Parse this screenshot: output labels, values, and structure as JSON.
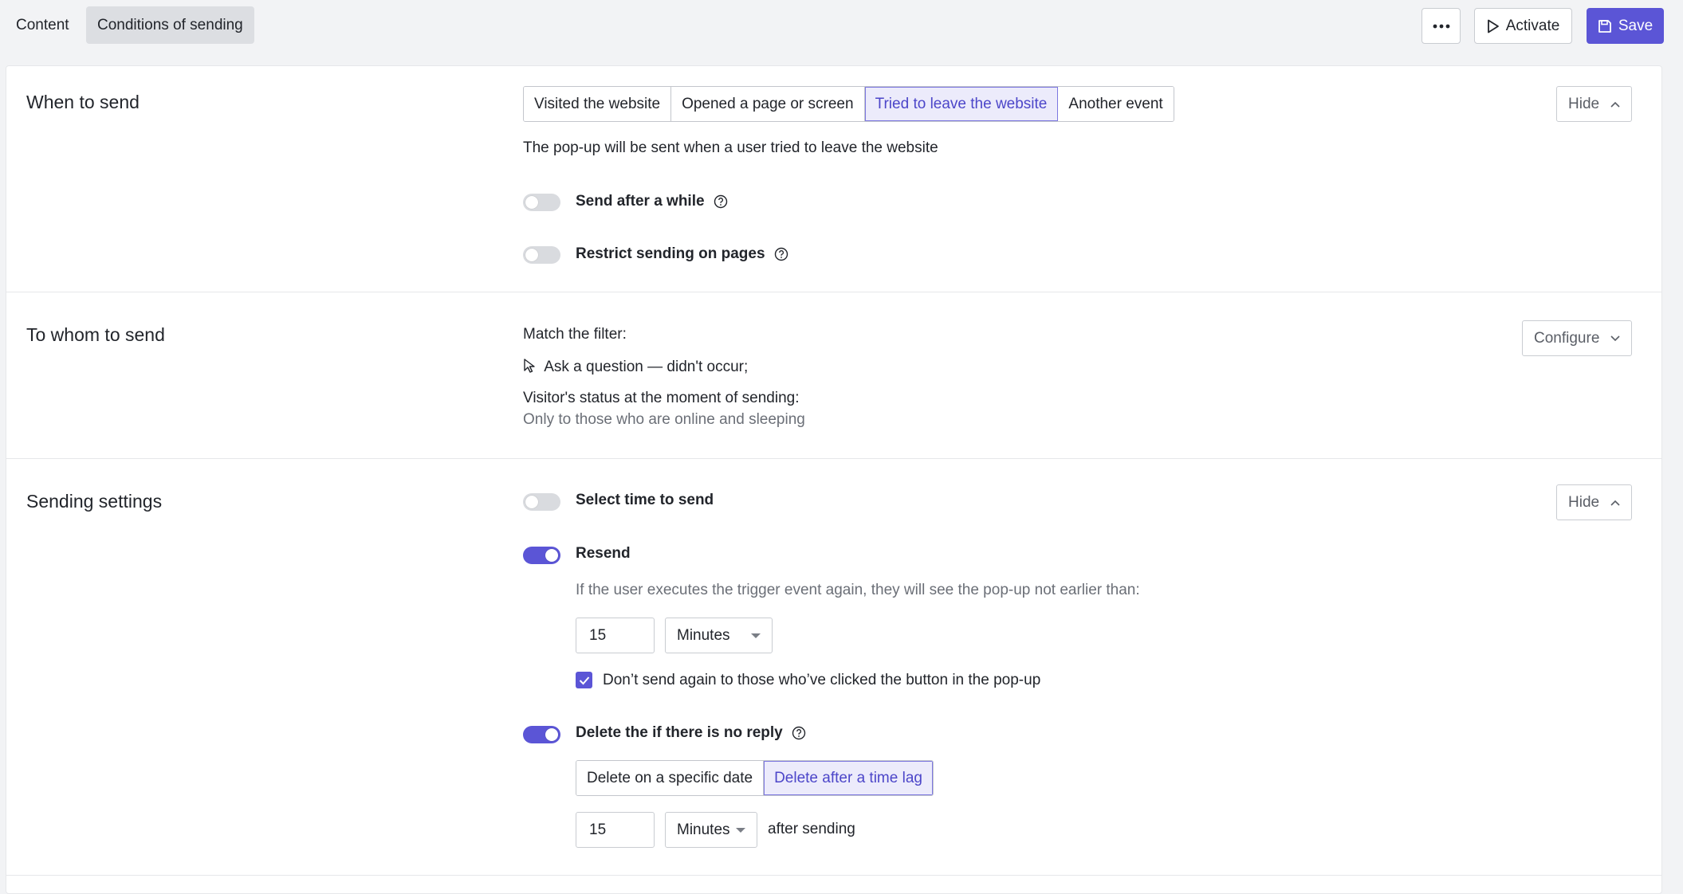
{
  "tabs": [
    {
      "label": "Content"
    },
    {
      "label": "Conditions of sending"
    }
  ],
  "toolbar": {
    "activate_label": "Activate",
    "save_label": "Save"
  },
  "when_to_send": {
    "title": "When to send",
    "options": [
      "Visited the website",
      "Opened a page or screen",
      "Tried to leave the website",
      "Another event"
    ],
    "selected": "Tried to leave the website",
    "hide_label": "Hide",
    "description": "The pop-up will be sent when a user tried to leave the website",
    "send_after_while": {
      "label": "Send after a while",
      "enabled": false
    },
    "restrict_pages": {
      "label": "Restrict sending on pages",
      "enabled": false
    }
  },
  "to_whom": {
    "title": "To whom to send",
    "configure_label": "Configure",
    "filter_heading": "Match the filter:",
    "filter_rule": "Ask a question — didn't occur;",
    "status_heading": "Visitor's status at the moment of sending:",
    "status_value": "Only to those who are online and sleeping"
  },
  "sending_settings": {
    "title": "Sending settings",
    "hide_label": "Hide",
    "select_time": {
      "label": "Select time to send",
      "enabled": false
    },
    "resend": {
      "label": "Resend",
      "enabled": true,
      "hint": "If the user executes the trigger event again, they will see the pop-up not earlier than:",
      "amount": "15",
      "unit": "Minutes",
      "dont_send_again": {
        "label": "Don’t send again to those who’ve clicked the button in the pop-up",
        "checked": true
      }
    },
    "delete_no_reply": {
      "label": "Delete the if there is no reply",
      "enabled": true,
      "options": [
        "Delete on a specific date",
        "Delete after a time lag"
      ],
      "selected": "Delete after a time lag",
      "amount": "15",
      "unit": "Minutes",
      "suffix": "after sending"
    }
  },
  "colors": {
    "accent": "#5b55d6",
    "accent_light": "#ecebfb"
  }
}
